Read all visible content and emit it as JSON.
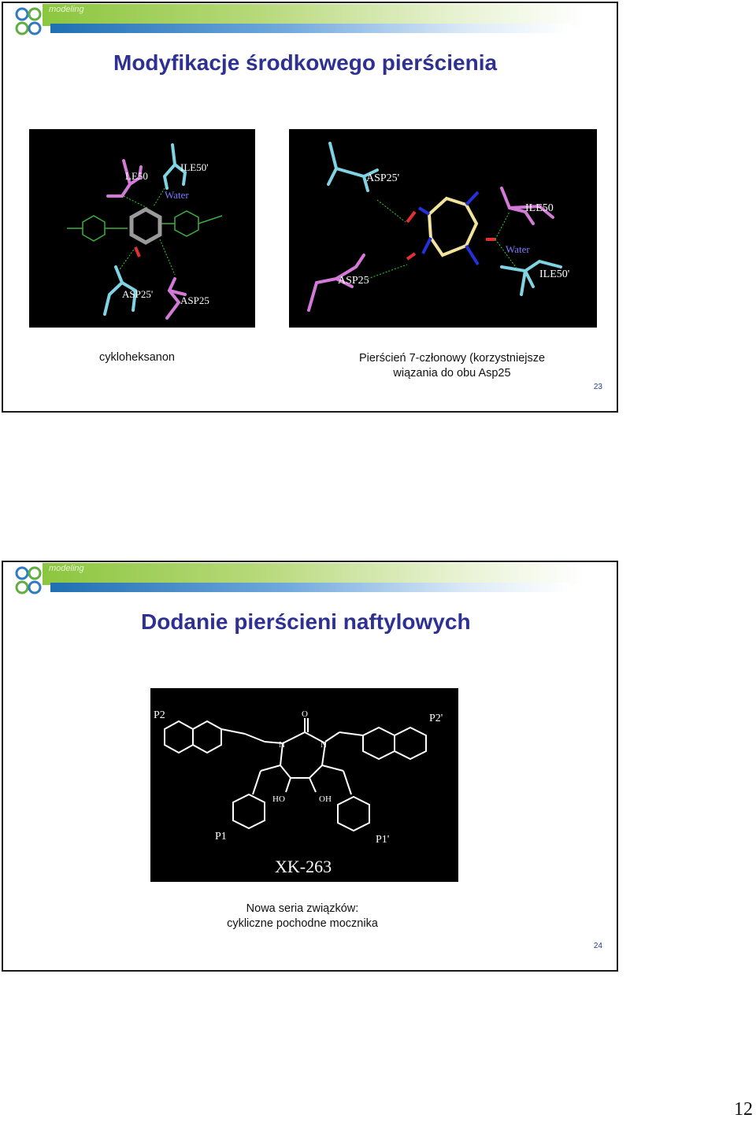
{
  "slide1": {
    "logo_text": "modeling",
    "title": "Modyfikacje środkowego pierścienia",
    "left_image": {
      "labels": [
        "LE50",
        "ILE50'",
        "Water",
        "ASP25'",
        "ASP25"
      ]
    },
    "right_image": {
      "labels": [
        "ASP25'",
        "ILE50",
        "Water",
        "ASP25",
        "ILE50'"
      ]
    },
    "caption_left": "cykloheksanon",
    "caption_right_line1": "Pierścień 7-członowy (korzystniejsze",
    "caption_right_line2": "wiązania do obu Asp25",
    "slide_number": "23"
  },
  "slide2": {
    "logo_text": "modeling",
    "title": "Dodanie pierścieni naftylowych",
    "structure": {
      "labels": [
        "P2",
        "O",
        "P2'",
        "N",
        "N",
        "HO",
        "OH",
        "P1",
        "P1'"
      ],
      "compound": "XK-263"
    },
    "caption_line1": "Nowa seria związków:",
    "caption_line2": "cykliczne pochodne mocznika",
    "slide_number": "24"
  },
  "page_number": "12",
  "colors": {
    "title": "#2e3192",
    "cyan": "#7fd3e3",
    "magenta": "#d37ad8",
    "yellow": "#f3e29c",
    "blue": "#2430d8",
    "green": "#3fae3f"
  }
}
